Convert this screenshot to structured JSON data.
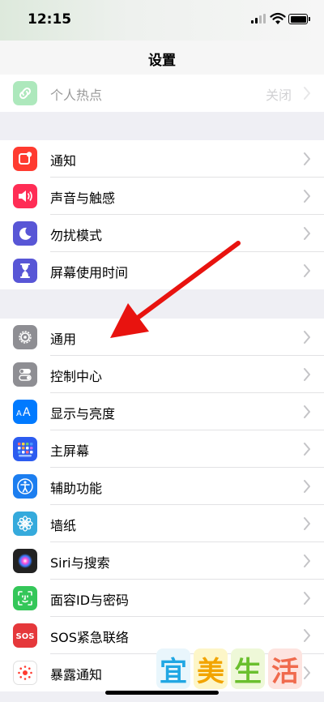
{
  "status": {
    "time": "12:15"
  },
  "nav": {
    "title": "设置"
  },
  "groups": [
    {
      "items": [
        {
          "label": "个人热点",
          "value": "关闭",
          "icon": "hotspot-icon",
          "color": "#34c759"
        }
      ]
    },
    {
      "items": [
        {
          "label": "通知",
          "icon": "notifications-icon",
          "color": "#ff3b30"
        },
        {
          "label": "声音与触感",
          "icon": "sound-icon",
          "color": "#ff2d55"
        },
        {
          "label": "勿扰模式",
          "icon": "moon-icon",
          "color": "#5856d6"
        },
        {
          "label": "屏幕使用时间",
          "icon": "hourglass-icon",
          "color": "#5856d6"
        }
      ]
    },
    {
      "items": [
        {
          "label": "通用",
          "icon": "gear-icon",
          "color": "#8e8e93"
        },
        {
          "label": "控制中心",
          "icon": "toggles-icon",
          "color": "#8e8e93"
        },
        {
          "label": "显示与亮度",
          "icon": "text-size-icon",
          "color": "#007aff"
        },
        {
          "label": "主屏幕",
          "icon": "home-screen-grid-icon",
          "color": "#2c5cf0"
        },
        {
          "label": "辅助功能",
          "icon": "accessibility-icon",
          "color": "#1c7ef0"
        },
        {
          "label": "墙纸",
          "icon": "flower-icon",
          "color": "#35aadc"
        },
        {
          "label": "Siri与搜索",
          "icon": "siri-icon",
          "color": "#222222"
        },
        {
          "label": "面容ID与密码",
          "icon": "face-id-icon",
          "color": "#34c759"
        },
        {
          "label": "SOS紧急联络",
          "icon": "sos-icon",
          "color": "#e5383b"
        },
        {
          "label": "暴露通知",
          "icon": "exposure-icon",
          "color": "#ffffff"
        }
      ]
    }
  ],
  "watermark": {
    "chars": [
      "宜",
      "美",
      "生",
      "活"
    ]
  }
}
